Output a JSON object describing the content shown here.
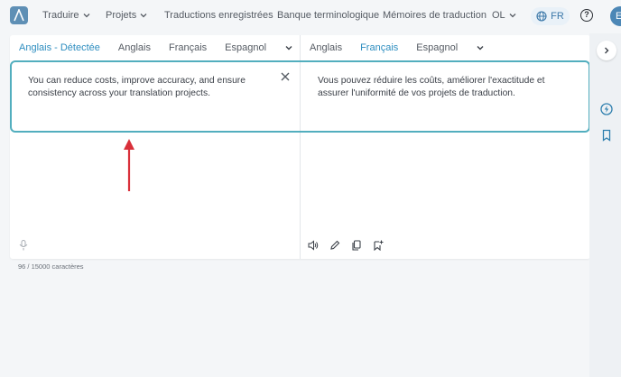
{
  "nav": {
    "translate": "Traduire",
    "projects": "Projets",
    "saved": "Traductions enregistrées",
    "termbank": "Banque terminologique",
    "memories": "Mémoires de traduction",
    "user_initials": "OL",
    "ui_language": "FR",
    "avatar_letter": "E"
  },
  "source": {
    "tabs": [
      "Anglais - Détectée",
      "Anglais",
      "Français",
      "Espagnol"
    ],
    "active_tab": "Anglais - Détectée",
    "text": "You can reduce costs, improve accuracy, and ensure consistency across your translation projects.",
    "char_count": "96 / 15000 caractères"
  },
  "target": {
    "tabs": [
      "Anglais",
      "Français",
      "Espagnol"
    ],
    "active_tab": "Français",
    "text": "Vous pouvez réduire les coûts, améliorer l'exactitude et assurer l'uniformité de vos projets de traduction."
  },
  "colors": {
    "accent": "#2e8ec0",
    "highlight": "#52aebe",
    "annotation_arrow": "#d9303a"
  },
  "icons": [
    "chevron-down-icon",
    "globe-icon",
    "help-icon",
    "close-icon",
    "microphone-icon",
    "speaker-icon",
    "edit-icon",
    "copy-icon",
    "bookmark-add-icon",
    "chevron-right-icon",
    "bolt-icon",
    "bookmark-icon"
  ]
}
